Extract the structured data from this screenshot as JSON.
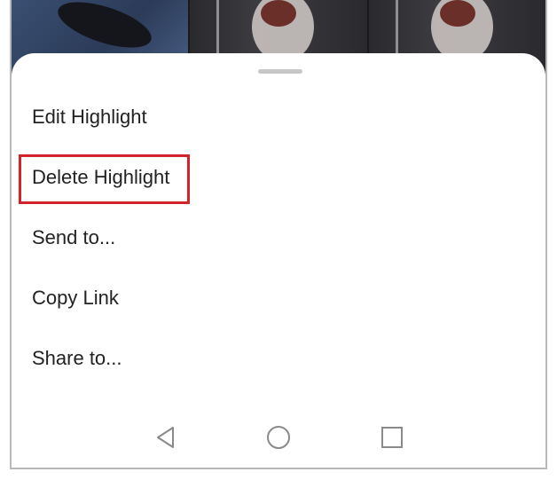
{
  "menu": {
    "items": [
      {
        "label": "Edit Highlight"
      },
      {
        "label": "Delete Highlight"
      },
      {
        "label": "Send to..."
      },
      {
        "label": "Copy Link"
      },
      {
        "label": "Share to..."
      }
    ],
    "highlighted_index": 1
  },
  "nav_bar": {
    "icons": [
      "back-triangle-icon",
      "home-circle-icon",
      "recents-square-icon"
    ]
  },
  "colors": {
    "highlight_outline": "#d2232a",
    "sheet_background": "#ffffff",
    "text": "#222222",
    "nav_icon": "#8a8a8a"
  }
}
